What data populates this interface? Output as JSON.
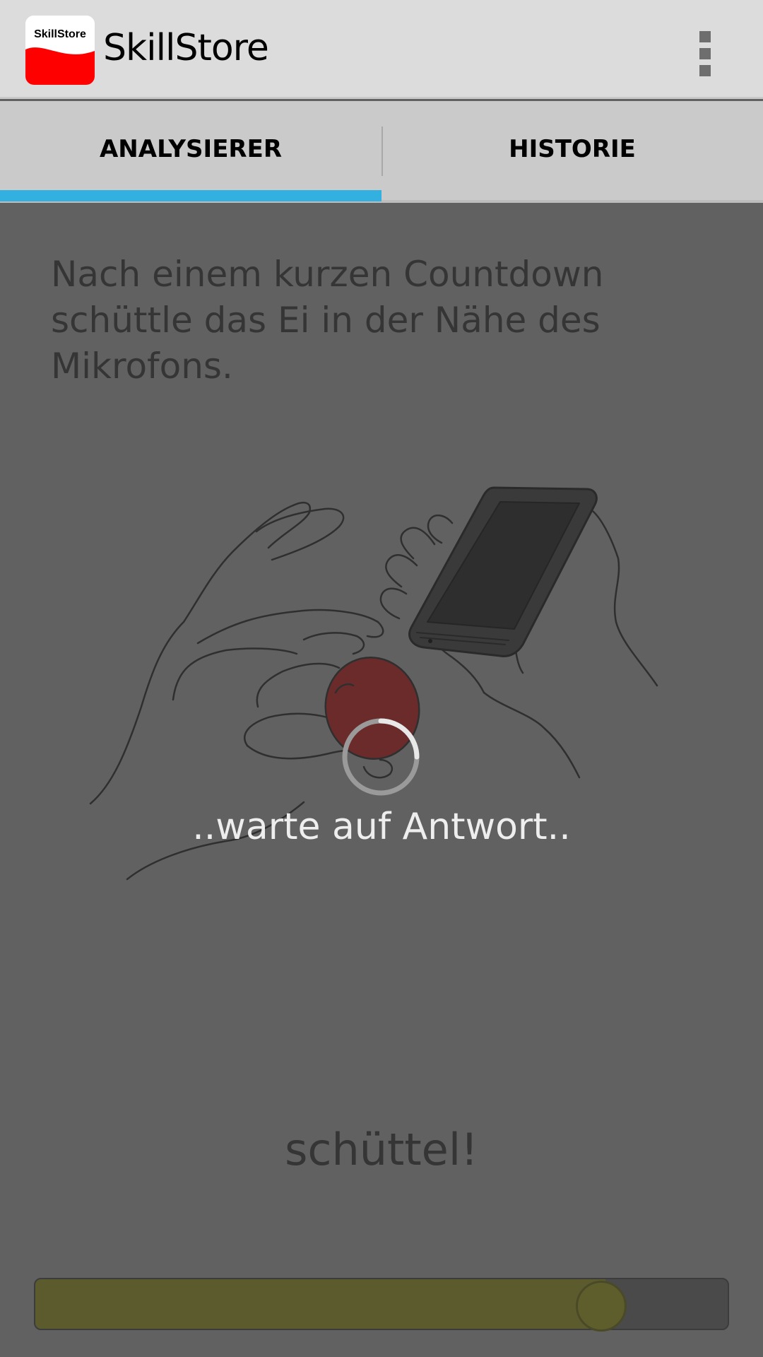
{
  "app": {
    "title": "SkillStore",
    "icon_text": "SkillStore",
    "icon_name": "skillstore-logo",
    "brand_color": "#ff0000"
  },
  "menu": {
    "icon_name": "overflow-menu-icon"
  },
  "tabs": [
    {
      "label": "ANALYSIERER",
      "selected": true
    },
    {
      "label": "HISTORIE",
      "selected": false
    }
  ],
  "colors": {
    "tab_indicator": "#32b0e0",
    "egg": "#6b2b2b"
  },
  "main": {
    "instructions": "Nach einem kurzen Countdown schüttle das Ei in der Nähe des Mikrofons.",
    "illustration_icon": "hands-shaking-egg-near-phone-illustration",
    "loading_text": "..warte auf Antwort..",
    "shake_label": "schüttel!",
    "level_fraction": 0.82
  }
}
